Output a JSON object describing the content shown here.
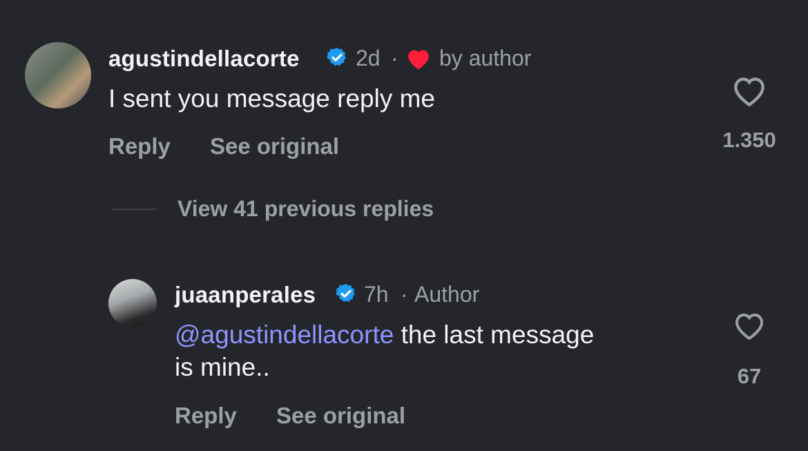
{
  "comments": [
    {
      "username": "agustindellacorte",
      "time": "2d",
      "separator": "·",
      "liked_by": "by author",
      "text": "I sent you message reply me",
      "reply_label": "Reply",
      "see_original_label": "See original",
      "like_count": "1.350"
    }
  ],
  "replies_toggle": "View 41 previous replies",
  "reply": {
    "username": "juaanperales",
    "time": "7h",
    "separator": "·",
    "author_badge": "Author",
    "mention": "@agustindellacorte",
    "text": " the last message",
    "text_line2": "is mine..",
    "reply_label": "Reply",
    "see_original_label": "See original",
    "like_count": "67"
  },
  "colors": {
    "background": "#24262b",
    "mention": "#8f94ff",
    "verified": "#1d9bf0",
    "heart": "#ff1f3d"
  },
  "icons": [
    "verified-badge-icon",
    "heart-filled-icon",
    "heart-outline-icon"
  ]
}
